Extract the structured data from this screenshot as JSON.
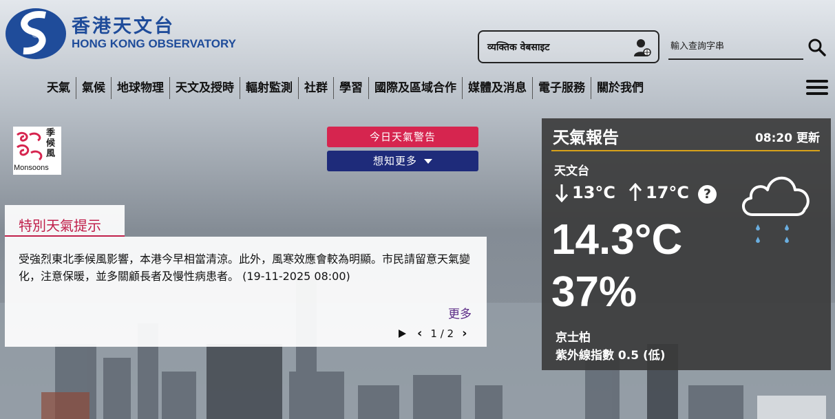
{
  "header": {
    "logo_cn": "香港天文台",
    "logo_en": "HONG KONG OBSERVATORY",
    "personal_website_label": "व्यक्तिक वेबसाइट",
    "search_placeholder": "輸入查詢字串"
  },
  "nav": {
    "items": [
      "天氣",
      "氣候",
      "地球物理",
      "天文及授時",
      "輻射監測",
      "社群",
      "學習",
      "國際及區域合作",
      "媒體及消息",
      "電子服務",
      "關於我們"
    ]
  },
  "monsoon_badge": {
    "cn": "季候風",
    "en": "Monsoons"
  },
  "buttons": {
    "warning": "今日天氣警告",
    "learn_more": "想知更多"
  },
  "special_tip": {
    "tab_label": "特別天氣提示",
    "text": "受強烈東北季候風影響，本港今早相當清涼。此外，風寒效應會較為明顯。市民請留意天氣變化，注意保暖，並多關顧長者及慢性病患者。 (19-11-2025 08:00)",
    "more": "更多",
    "pager": "1 / 2"
  },
  "weather": {
    "title": "天氣報告",
    "update": "08:20 更新",
    "station": "天文台",
    "min_temp": "13°C",
    "max_temp": "17°C",
    "help": "?",
    "current_temp": "14.3°C",
    "humidity": "37%",
    "place": "京士柏",
    "uv": "紫外線指數 0.5 (低)",
    "icon": "cloud-rain-icon"
  },
  "colors": {
    "brand_blue": "#1f4c9a",
    "warning_red": "#d6254f",
    "navy": "#1e2b7a",
    "accent_gold": "#d8a21a",
    "tip_red": "#c01f4a"
  }
}
